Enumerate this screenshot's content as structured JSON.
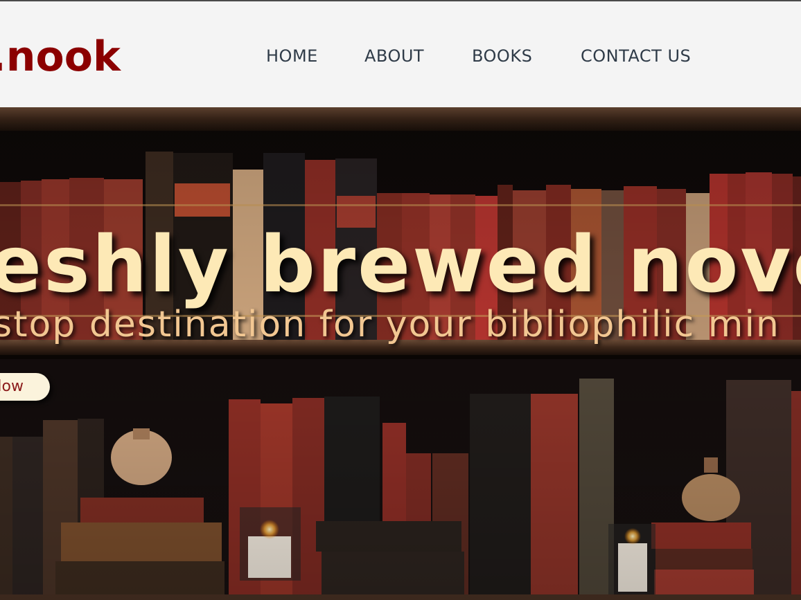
{
  "brand": {
    "logo_text": ".nook",
    "logo_color": "#8b0000"
  },
  "nav": {
    "items": [
      {
        "label": "HOME"
      },
      {
        "label": "ABOUT"
      },
      {
        "label": "BOOKS"
      },
      {
        "label": "CONTACT US"
      }
    ]
  },
  "hero": {
    "heading": "eshly brewed nove",
    "subheading": "stop destination for your bibliophilic min",
    "cta_label": "low",
    "background": "bookshelf-photo"
  },
  "colors": {
    "nav_bg": "#f4f4f4",
    "nav_text": "#2f3b48",
    "heading": "#fde9b6",
    "subheading": "#f2c792",
    "cta_bg": "#fbf3dc",
    "cta_text": "#8b1a1a"
  }
}
